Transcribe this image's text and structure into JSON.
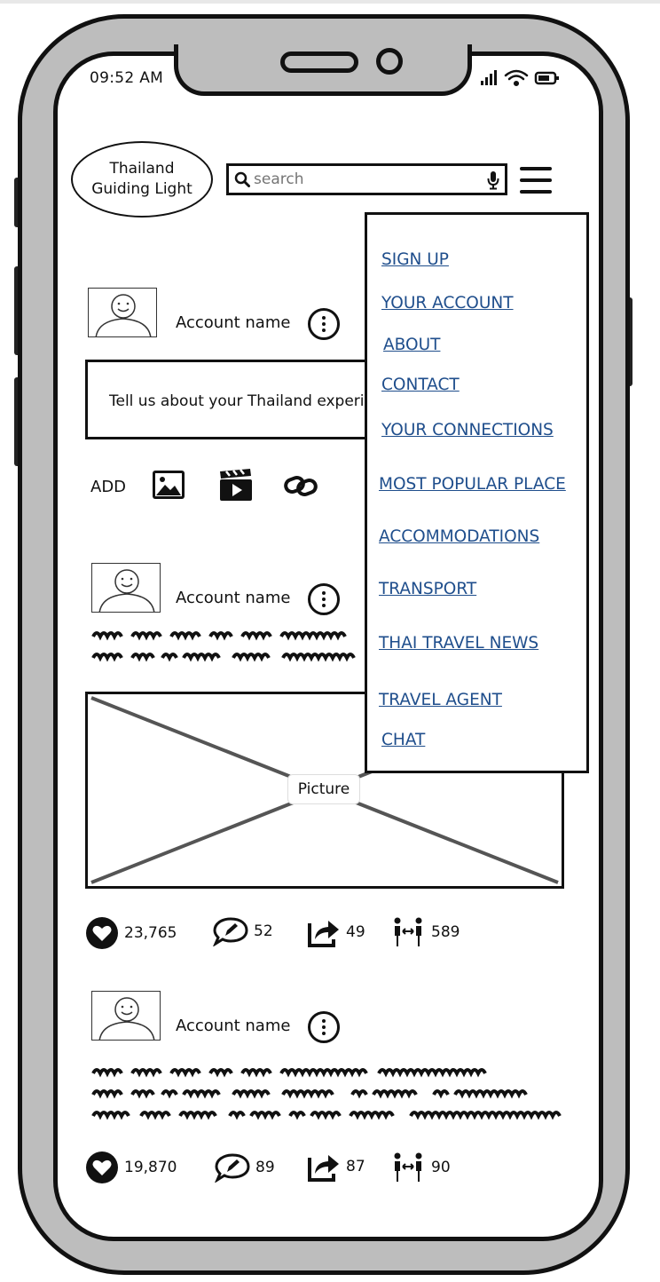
{
  "status_bar": {
    "time": "09:52 AM"
  },
  "header": {
    "logo_text": "Thailand\nGuiding Light",
    "search": {
      "placeholder": "search",
      "value": ""
    }
  },
  "compose": {
    "account_name": "Account name",
    "prompt": "Tell us about your Thailand experience",
    "add_label": "ADD"
  },
  "posts": [
    {
      "account_name": "Account name",
      "picture_label": "Picture",
      "stats": {
        "likes": "23,765",
        "comments": "52",
        "shares": "49",
        "connections": "589"
      }
    },
    {
      "account_name": "Account name",
      "stats": {
        "likes": "19,870",
        "comments": "89",
        "shares": "87",
        "connections": "90"
      }
    }
  ],
  "menu": {
    "items": [
      "SIGN UP",
      "YOUR ACCOUNT",
      "ABOUT",
      "CONTACT",
      "YOUR CONNECTIONS",
      "MOST POPULAR PLACE",
      "ACCOMMODATIONS",
      "TRANSPORT",
      "THAI TRAVEL NEWS",
      "TRAVEL AGENT",
      "CHAT"
    ]
  },
  "colors": {
    "link": "#1f4e8c",
    "frame": "#bdbdbd",
    "ink": "#111111"
  },
  "icons": [
    "search-icon",
    "mic-icon",
    "menu-icon",
    "more-options-icon",
    "image-icon",
    "video-icon",
    "link-icon",
    "heart-icon",
    "comment-icon",
    "share-icon",
    "connections-icon",
    "signal-icon",
    "wifi-icon",
    "battery-icon"
  ]
}
